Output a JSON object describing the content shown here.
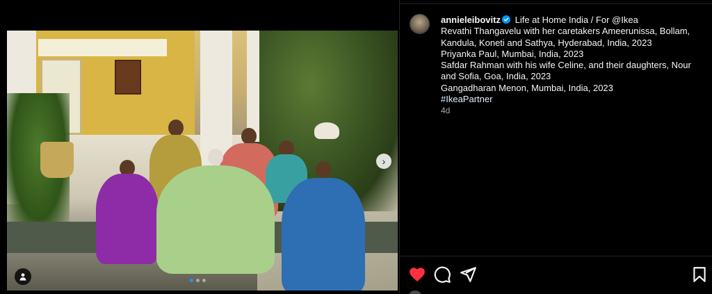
{
  "post": {
    "username": "annieleibovitz",
    "verified": true,
    "title_line": "Life at Home India / For @Ikea",
    "caption_lines": [
      "Revathi Thangavelu with her caretakers Ameerunissa, Bollam,",
      "Kandula, Koneti and Sathya, Hyderabad, India, 2023",
      "Priyanka Paul, Mumbai, India, 2023",
      "Safdar Rahman with his wife Celine, and their daughters, Nour",
      "and Sofia, Goa, India, 2023",
      "Gangadharan Menon, Mumbai, India, 2023"
    ],
    "hashtag": "#IkeaPartner",
    "timestamp": "4d"
  },
  "media": {
    "carousel_count": 3,
    "carousel_active_index": 0
  },
  "actions": {
    "liked": true,
    "like_color": "#ff3040"
  },
  "icons": {
    "verified": "verified-badge-icon",
    "next": "chevron-right-icon",
    "user_tag": "user-tag-icon",
    "like": "heart-icon",
    "comment": "comment-icon",
    "share": "paper-plane-icon",
    "save": "bookmark-icon"
  },
  "colors": {
    "background": "#000000",
    "text": "#f5f5f5",
    "hashtag": "#e0f1ff",
    "secondary_text": "#a8a8a8",
    "verified": "#0095f6",
    "carousel_active": "#2f8cff"
  }
}
